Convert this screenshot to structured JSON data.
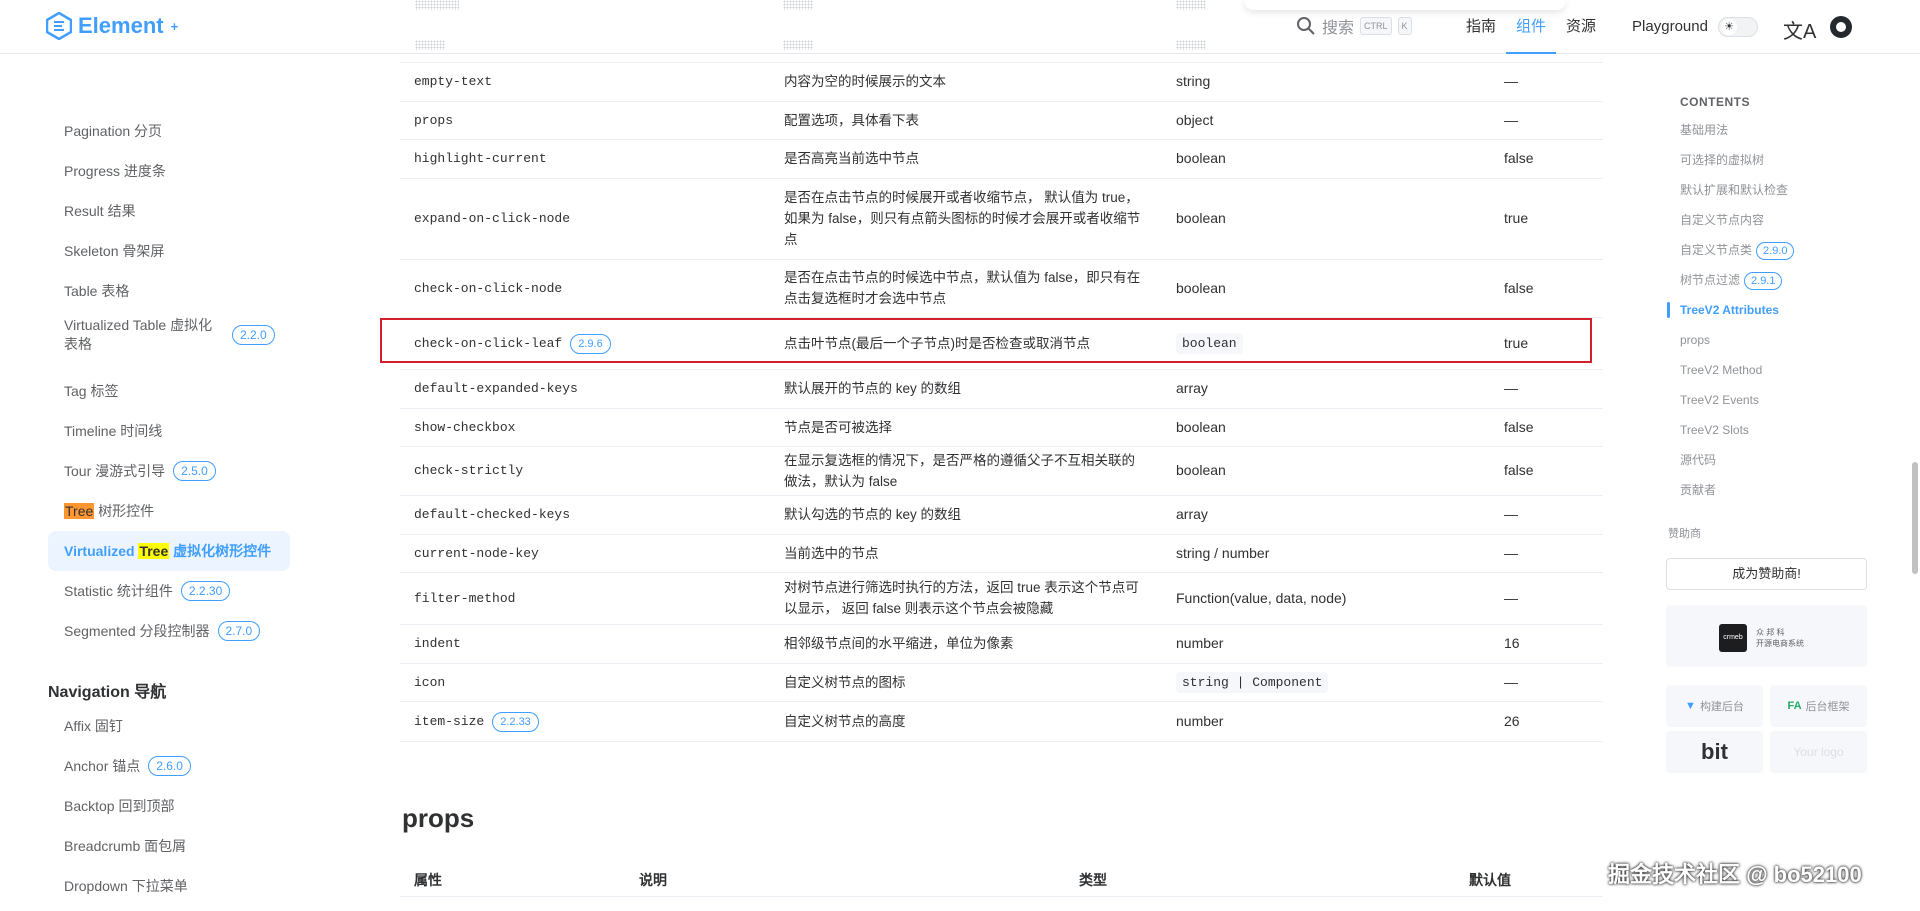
{
  "header": {
    "logo_text": "Element",
    "logo_sup": "+",
    "search_placeholder": "搜索",
    "kbd_ctrl": "CTRL",
    "kbd_k": "K",
    "nav": [
      {
        "label": "指南",
        "active": false
      },
      {
        "label": "组件",
        "active": true
      },
      {
        "label": "资源",
        "active": false
      }
    ],
    "playground": "Playground"
  },
  "sidebar": {
    "items": [
      {
        "label": "Pagination 分页",
        "badge": ""
      },
      {
        "label": "Progress 进度条",
        "badge": ""
      },
      {
        "label": "Result 结果",
        "badge": ""
      },
      {
        "label": "Skeleton 骨架屏",
        "badge": ""
      },
      {
        "label": "Table 表格",
        "badge": ""
      },
      {
        "label_line1": "Virtualized Table 虚拟化",
        "label_line2": "表格",
        "badge": "2.2.0"
      },
      {
        "label": "Tag 标签",
        "badge": ""
      },
      {
        "label": "Timeline 时间线",
        "badge": ""
      },
      {
        "label": "Tour 漫游式引导",
        "badge": "2.5.0"
      },
      {
        "label_pre": "",
        "label_hl": "Tree",
        "label_post": " 树形控件",
        "badge": ""
      },
      {
        "label_pre": "Virtualized ",
        "label_hl": "Tree",
        "label_post": " 虚拟化树形控件",
        "badge": "",
        "active": true
      },
      {
        "label": "Statistic 统计组件",
        "badge": "2.2.30"
      },
      {
        "label": "Segmented 分段控制器",
        "badge": "2.7.0"
      }
    ],
    "section_title": "Navigation 导航",
    "nav_items": [
      {
        "label": "Affix 固钉",
        "badge": ""
      },
      {
        "label": "Anchor 锚点",
        "badge": "2.6.0"
      },
      {
        "label": "Backtop 回到顶部",
        "badge": ""
      },
      {
        "label": "Breadcrumb 面包屑",
        "badge": ""
      },
      {
        "label": "Dropdown 下拉菜单",
        "badge": ""
      }
    ]
  },
  "table": {
    "rows": [
      {
        "attr": "empty-text",
        "badge": "",
        "desc": "内容为空的时候展示的文本",
        "type": "string",
        "type_code": false,
        "default": "—"
      },
      {
        "attr": "props",
        "badge": "",
        "desc": "配置选项，具体看下表",
        "type": "object",
        "type_code": false,
        "default": "—"
      },
      {
        "attr": "highlight-current",
        "badge": "",
        "desc": "是否高亮当前选中节点",
        "type": "boolean",
        "type_code": false,
        "default": "false"
      },
      {
        "attr": "expand-on-click-node",
        "badge": "",
        "desc": "是否在点击节点的时候展开或者收缩节点， 默认值为 true，如果为 false，则只有点箭头图标的时候才会展开或者收缩节点",
        "type": "boolean",
        "type_code": false,
        "default": "true"
      },
      {
        "attr": "check-on-click-node",
        "badge": "",
        "desc": "是否在点击节点的时候选中节点，默认值为 false，即只有在点击复选框时才会选中节点",
        "type": "boolean",
        "type_code": false,
        "default": "false"
      },
      {
        "attr": "check-on-click-leaf",
        "badge": "2.9.6",
        "desc": "点击叶节点(最后一个子节点)时是否检查或取消节点",
        "type": "boolean",
        "type_code": true,
        "default": "true"
      },
      {
        "attr": "default-expanded-keys",
        "badge": "",
        "desc": "默认展开的节点的 key 的数组",
        "type": "array",
        "type_code": false,
        "default": "—"
      },
      {
        "attr": "show-checkbox",
        "badge": "",
        "desc": "节点是否可被选择",
        "type": "boolean",
        "type_code": false,
        "default": "false"
      },
      {
        "attr": "check-strictly",
        "badge": "",
        "desc": "在显示复选框的情况下，是否严格的遵循父子不互相关联的做法，默认为 false",
        "type": "boolean",
        "type_code": false,
        "default": "false"
      },
      {
        "attr": "default-checked-keys",
        "badge": "",
        "desc": "默认勾选的节点的 key 的数组",
        "type": "array",
        "type_code": false,
        "default": "—"
      },
      {
        "attr": "current-node-key",
        "badge": "",
        "desc": "当前选中的节点",
        "type": "string / number",
        "type_code": false,
        "default": "—"
      },
      {
        "attr": "filter-method",
        "badge": "",
        "desc": "对树节点进行筛选时执行的方法，返回 true 表示这个节点可以显示， 返回  false  则表示这个节点会被隐藏",
        "type": "Function(value, data, node)",
        "type_code": false,
        "default": "—"
      },
      {
        "attr": "indent",
        "badge": "",
        "desc": "相邻级节点间的水平缩进，单位为像素",
        "type": "number",
        "type_code": false,
        "default": "16"
      },
      {
        "attr": "icon",
        "badge": "",
        "desc": "自定义树节点的图标",
        "type": "string | Component",
        "type_code": true,
        "default": "—"
      },
      {
        "attr": "item-size",
        "badge": "2.2.33",
        "desc": "自定义树节点的高度",
        "type": "number",
        "type_code": false,
        "default": "26"
      }
    ]
  },
  "props_section": {
    "title": "props",
    "headers": [
      "属性",
      "说明",
      "类型",
      "默认值"
    ]
  },
  "toc": {
    "title": "CONTENTS",
    "items": [
      {
        "label": "基础用法",
        "badge": ""
      },
      {
        "label": "可选择的虚拟树",
        "badge": ""
      },
      {
        "label": "默认扩展和默认检查",
        "badge": ""
      },
      {
        "label": "自定义节点内容",
        "badge": ""
      },
      {
        "label": "自定义节点类",
        "badge": "2.9.0"
      },
      {
        "label": "树节点过滤",
        "badge": "2.9.1"
      },
      {
        "label": "TreeV2 Attributes",
        "badge": "",
        "active": true
      },
      {
        "label": "props",
        "badge": ""
      },
      {
        "label": "TreeV2 Method",
        "badge": ""
      },
      {
        "label": "TreeV2 Events",
        "badge": ""
      },
      {
        "label": "TreeV2 Slots",
        "badge": ""
      },
      {
        "label": "源代码",
        "badge": ""
      },
      {
        "label": "贡献者",
        "badge": ""
      }
    ],
    "sponsor_label": "赞助商",
    "sponsor_button": "成为赞助商!",
    "sponsor_card_logo": "crmeb",
    "sponsor_card_text1": "众 邦 科",
    "sponsor_card_text2": "开源电商系统",
    "small_sponsors": [
      "构建后台",
      "后台框架",
      "bit",
      "Your logo"
    ]
  },
  "watermark": "掘金技术社区 @ bo52100",
  "colors": {
    "primary": "#409eff",
    "highlight_border": "#d4202a"
  }
}
